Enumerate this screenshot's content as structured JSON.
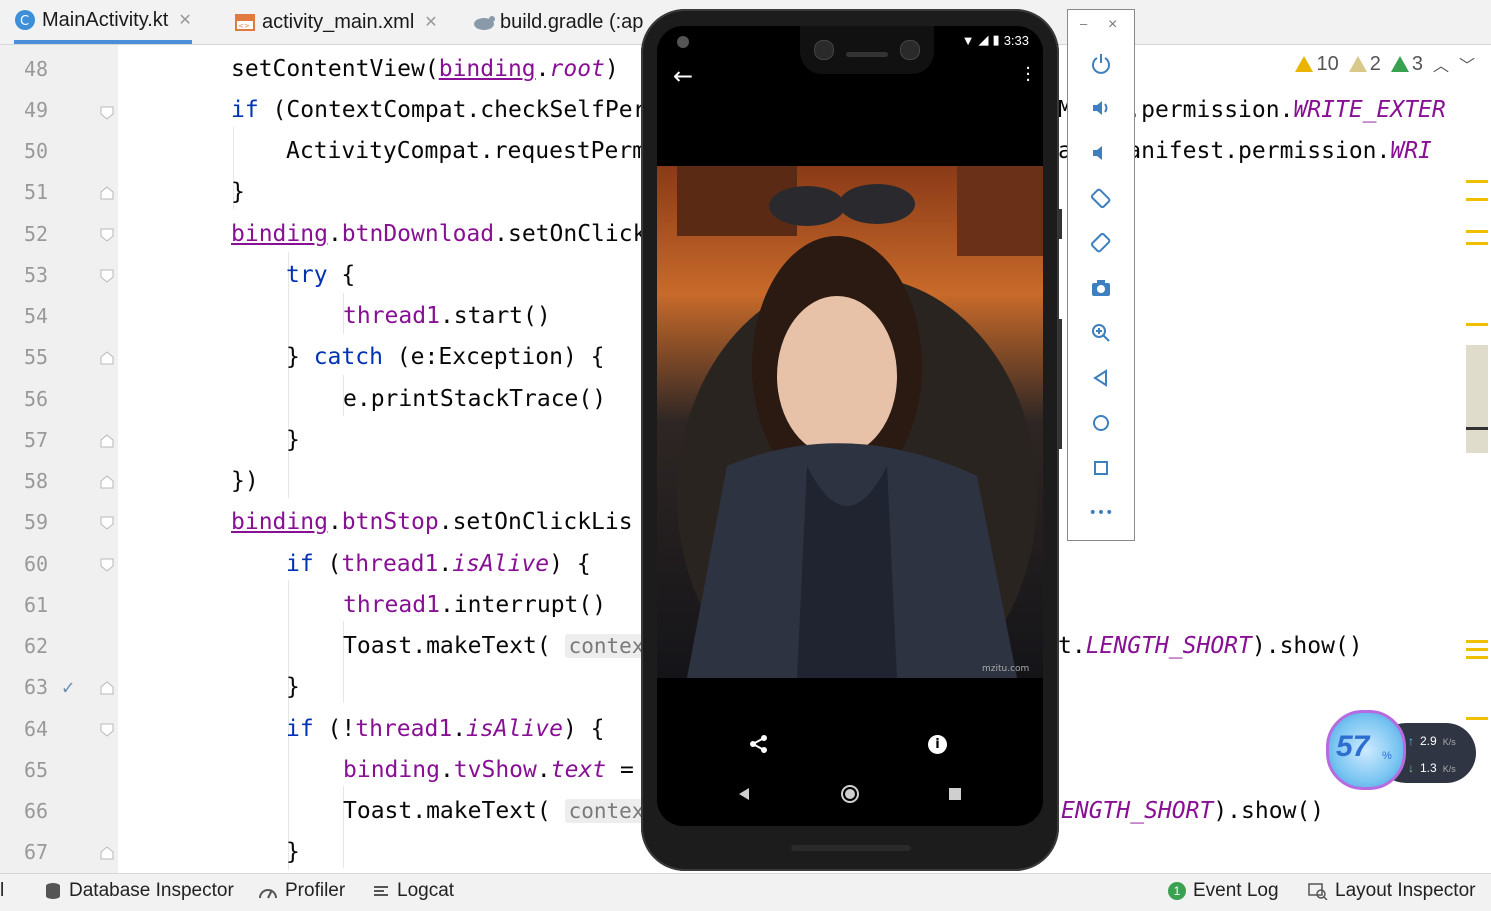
{
  "tabs": [
    {
      "label": "MainActivity.kt",
      "active": true,
      "icon": "kotlin-class-icon"
    },
    {
      "label": "activity_main.xml",
      "active": false,
      "icon": "xml-layout-icon"
    },
    {
      "label": "build.gradle (:ap",
      "active": false,
      "icon": "gradle-icon"
    }
  ],
  "inspections": {
    "errors_weak": "10",
    "warnings": "2",
    "typos": "3"
  },
  "line_numbers": [
    "48",
    "49",
    "50",
    "51",
    "52",
    "53",
    "54",
    "55",
    "56",
    "57",
    "58",
    "59",
    "60",
    "61",
    "62",
    "63",
    "64",
    "65",
    "66",
    "67"
  ],
  "code": {
    "l48": {
      "a": "setContentView(",
      "b": "binding",
      "c": ".",
      "d": "root",
      "e": ")"
    },
    "l49": {
      "a": "if",
      "b": " (ContextCompat.checkSelfPer",
      "c": "M",
      "d": "est.permission.",
      "e": "WRITE_EXTER"
    },
    "l50": {
      "a": "ActivityCompat.requestPerm",
      "b": "a",
      "c": "d.Manifest.permission.",
      "d": "WRI"
    },
    "l51": "}",
    "l52": {
      "a": "binding",
      "b": ".",
      "c": "btnDownload",
      "d": ".setOnClick"
    },
    "l53": {
      "a": "try",
      "b": " {"
    },
    "l54": {
      "a": "thread1",
      "b": ".start()"
    },
    "l55": {
      "a": "} ",
      "b": "catch",
      "c": " (e:Exception) {"
    },
    "l56": "e.printStackTrace()",
    "l57": "}",
    "l58": "})",
    "l59": {
      "a": "binding",
      "b": ".",
      "c": "btnStop",
      "d": ".setOnClickLis"
    },
    "l60": {
      "a": "if",
      "b": " (",
      "c": "thread1",
      "d": ".",
      "e": "isAlive",
      "f": ") {"
    },
    "l61": {
      "a": "thread1",
      "b": ".interrupt()"
    },
    "l62": {
      "a": "Toast.makeText( ",
      "b": "context:",
      "c": "t.",
      "d": "LENGTH_SHORT",
      "e": ").show()"
    },
    "l63": "}",
    "l64": {
      "a": "if",
      "b": " (!",
      "c": "thread1",
      "d": ".",
      "e": "isAlive",
      "f": ") {"
    },
    "l65": {
      "a": "binding",
      "b": ".",
      "c": "tvShow",
      "d": ".",
      "e": "text",
      "f": " ="
    },
    "l66": {
      "a": "Toast.makeText( ",
      "b": "context:",
      "c": "ENGTH_SHORT",
      "d": ").show()"
    },
    "l67": "}"
  },
  "phone": {
    "time": "3:33",
    "watermark": "mzitu.com",
    "icons": [
      "back-arrow-icon",
      "overflow-menu-icon",
      "share-icon",
      "info-icon",
      "nav-back-icon",
      "nav-home-icon",
      "nav-recents-icon"
    ]
  },
  "emulator_panel": {
    "min_label": "–",
    "close_label": "×",
    "more_label": "•••",
    "buttons": [
      "power-icon",
      "volume-up-icon",
      "volume-down-icon",
      "rotate-left-icon",
      "rotate-right-icon",
      "camera-icon",
      "zoom-icon",
      "back-icon",
      "home-icon",
      "overview-icon",
      "more-icon"
    ]
  },
  "net_widget": {
    "percent": "57",
    "percent_suffix": "%",
    "up": "2.9",
    "down": "1.3",
    "unit": "K/s"
  },
  "statusbar": {
    "left_marker": "l",
    "database_inspector": "Database Inspector",
    "profiler": "Profiler",
    "logcat": "Logcat",
    "event_log_count": "1",
    "event_log": "Event Log",
    "layout_inspector": "Layout Inspector"
  },
  "colors": {
    "keyword": "#0033b3",
    "property": "#871094",
    "accent": "#4a8fd8",
    "warning": "#e8b400"
  }
}
